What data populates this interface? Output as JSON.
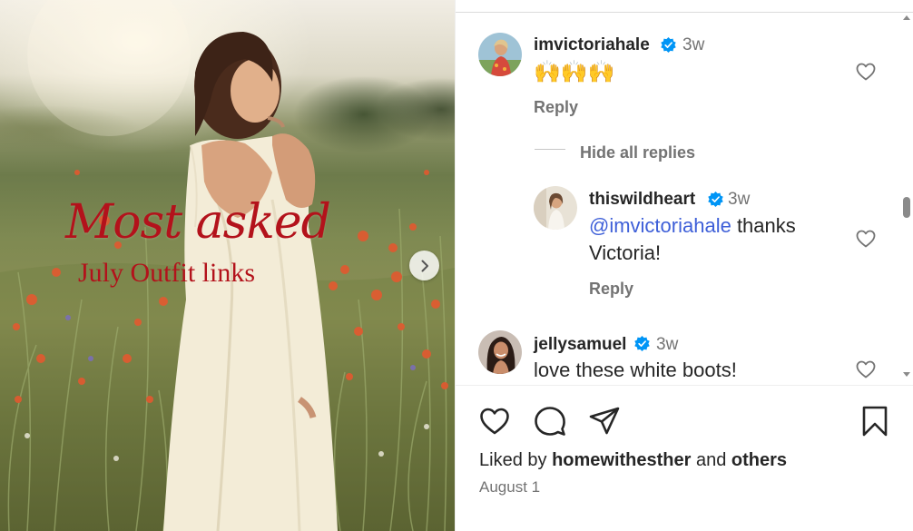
{
  "post": {
    "overlay_title": "Most asked",
    "overlay_subtitle": "July Outfit links"
  },
  "comments": [
    {
      "username": "imvictoriahale",
      "time": "3w",
      "text": "🙌🙌🙌",
      "reply_label": "Reply"
    },
    {
      "username": "thiswildheart",
      "time": "3w",
      "mention": "@imvictoriahale",
      "text_line1": " thanks",
      "text_line2": "Victoria!",
      "reply_label": "Reply"
    },
    {
      "username": "jellysamuel",
      "time": "3w",
      "text": "love these white boots!"
    }
  ],
  "hide_replies_label": "Hide all replies",
  "likes": {
    "prefix": "Liked by",
    "user": "homewithesther",
    "joiner": "and",
    "others": "others"
  },
  "date": "August 1",
  "icons": {
    "like": "heart-icon",
    "comment": "comment-bubble-icon",
    "share": "paper-plane-icon",
    "save": "bookmark-icon",
    "verified": "verified-badge-icon",
    "next": "chevron-right-icon"
  },
  "colors": {
    "verified": "#0095f6",
    "mention": "#3e5fd8",
    "overlay_text": "#b3121b",
    "muted": "#737373"
  }
}
